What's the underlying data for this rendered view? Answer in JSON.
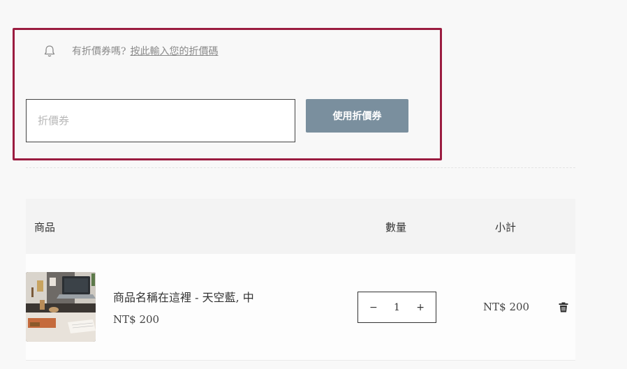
{
  "coupon": {
    "prompt": "有折價券嗎?",
    "link": "按此輸入您的折價碼",
    "input_placeholder": "折價券",
    "input_value": "",
    "apply_label": "使用折價券"
  },
  "cart": {
    "headers": {
      "product": "商品",
      "quantity": "數量",
      "subtotal": "小計"
    },
    "items": [
      {
        "name": "商品名稱在這裡 - 天空藍, 中",
        "price": "NT$ 200",
        "quantity": "1",
        "minus": "−",
        "plus": "+",
        "subtotal": "NT$ 200"
      }
    ]
  },
  "colors": {
    "highlight_border": "#9b1c40",
    "apply_button": "#7a8f9e",
    "background": "#f8f8f8"
  },
  "icons": [
    "bell-icon",
    "trash-icon"
  ]
}
